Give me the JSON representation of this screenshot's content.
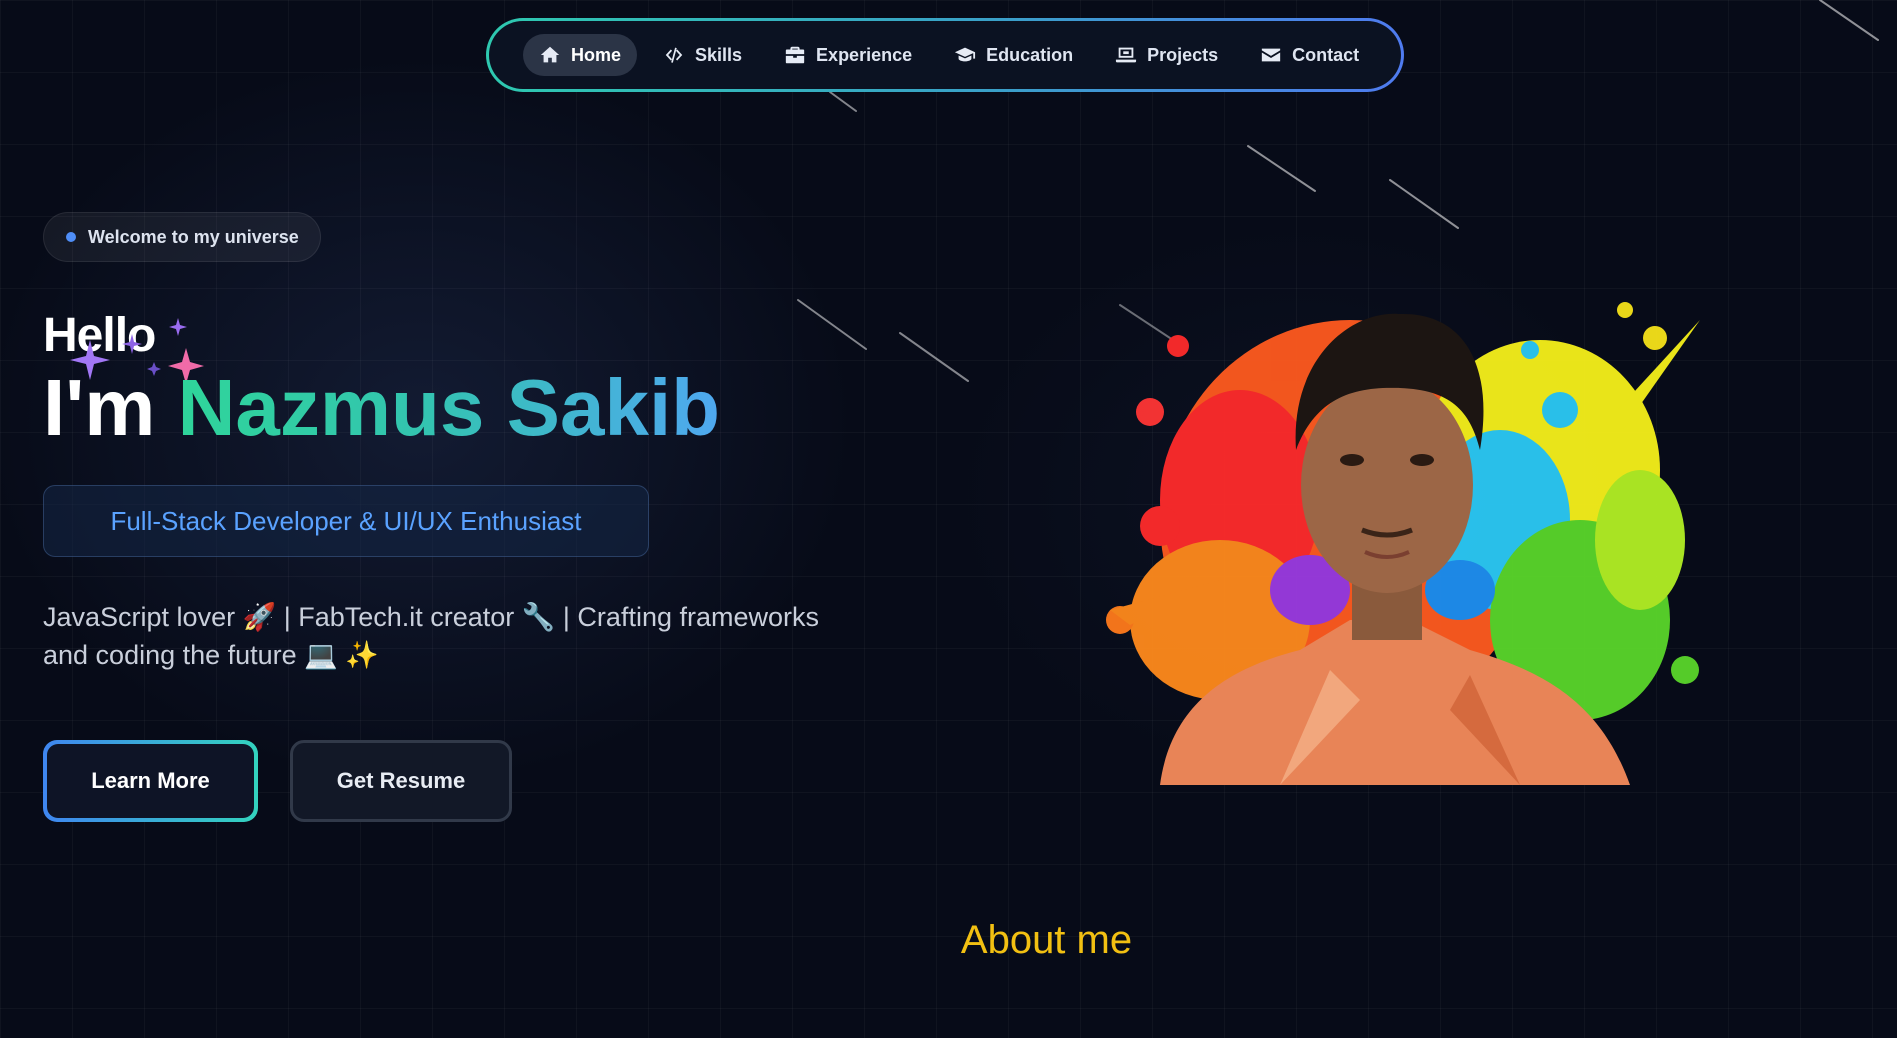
{
  "nav": {
    "items": [
      {
        "label": "Home",
        "icon": "home-icon",
        "active": true
      },
      {
        "label": "Skills",
        "icon": "code-icon",
        "active": false
      },
      {
        "label": "Experience",
        "icon": "briefcase-icon",
        "active": false
      },
      {
        "label": "Education",
        "icon": "graduation-cap-icon",
        "active": false
      },
      {
        "label": "Projects",
        "icon": "laptop-icon",
        "active": false
      },
      {
        "label": "Contact",
        "icon": "envelope-icon",
        "active": false
      }
    ],
    "border_colors": [
      "#2ec9b0",
      "#4f7bf0"
    ]
  },
  "hero": {
    "badge": "Welcome to my universe",
    "greeting": "Hello",
    "intro": "I'm",
    "name": "Nazmus Sakib",
    "role": "Full-Stack Developer & UI/UX Enthusiast",
    "tagline_line1": "JavaScript lover 🚀 | FabTech.it creator 🔧 | Crafting frameworks",
    "tagline_line2": "and coding the future 💻 ✨",
    "buttons": {
      "learn_more": "Learn More",
      "get_resume": "Get Resume"
    },
    "portrait": "portrait-with-paint-splash"
  },
  "about": {
    "heading": "About me"
  },
  "colors": {
    "background": "#070b18",
    "name_gradient": [
      "#2fd59a",
      "#4fa8f0"
    ],
    "role_text": "#5aa2ff",
    "about_heading": "#f2c012"
  }
}
